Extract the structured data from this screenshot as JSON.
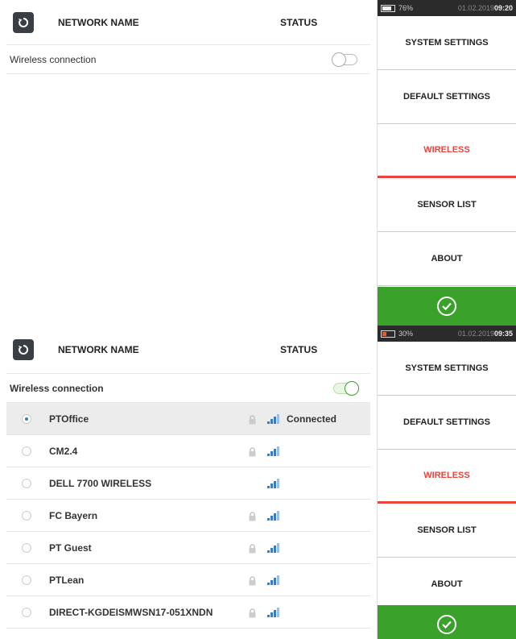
{
  "screen1": {
    "header": {
      "network_name": "NETWORK NAME",
      "status": "STATUS"
    },
    "wireless_connection": {
      "label": "Wireless connection",
      "enabled": false
    },
    "status_bar": {
      "battery": "76%",
      "date": "01.02.2019",
      "time": "09:20"
    },
    "menu": [
      "SYSTEM SETTINGS",
      "DEFAULT SETTINGS",
      "WIRELESS",
      "SENSOR LIST",
      "ABOUT"
    ],
    "active_menu": "WIRELESS"
  },
  "screen2": {
    "header": {
      "network_name": "NETWORK NAME",
      "status": "STATUS"
    },
    "wireless_connection": {
      "label": "Wireless connection",
      "enabled": true
    },
    "networks": [
      {
        "name": "PTOffice",
        "locked": true,
        "status": "Connected",
        "selected": true
      },
      {
        "name": "CM2.4",
        "locked": true,
        "status": "",
        "selected": false
      },
      {
        "name": "DELL 7700 WIRELESS",
        "locked": false,
        "status": "",
        "selected": false
      },
      {
        "name": "FC Bayern",
        "locked": true,
        "status": "",
        "selected": false
      },
      {
        "name": "PT Guest",
        "locked": true,
        "status": "",
        "selected": false
      },
      {
        "name": "PTLean",
        "locked": true,
        "status": "",
        "selected": false
      },
      {
        "name": "DIRECT-KGDEISMWSN17-051XNDN",
        "locked": true,
        "status": "",
        "selected": false
      }
    ],
    "status_bar": {
      "battery": "30%",
      "date": "01.02.2019",
      "time": "09:35"
    },
    "menu": [
      "SYSTEM SETTINGS",
      "DEFAULT SETTINGS",
      "WIRELESS",
      "SENSOR LIST",
      "ABOUT"
    ],
    "active_menu": "WIRELESS"
  },
  "colors": {
    "accent_red": "#e8453c",
    "confirm_green": "#3aa12a",
    "toggle_on": "#3aa12a"
  },
  "icons": {
    "refresh": "refresh-icon",
    "lock": "lock-icon",
    "signal": "wifi-signal-icon",
    "confirm": "checkmark-icon"
  }
}
